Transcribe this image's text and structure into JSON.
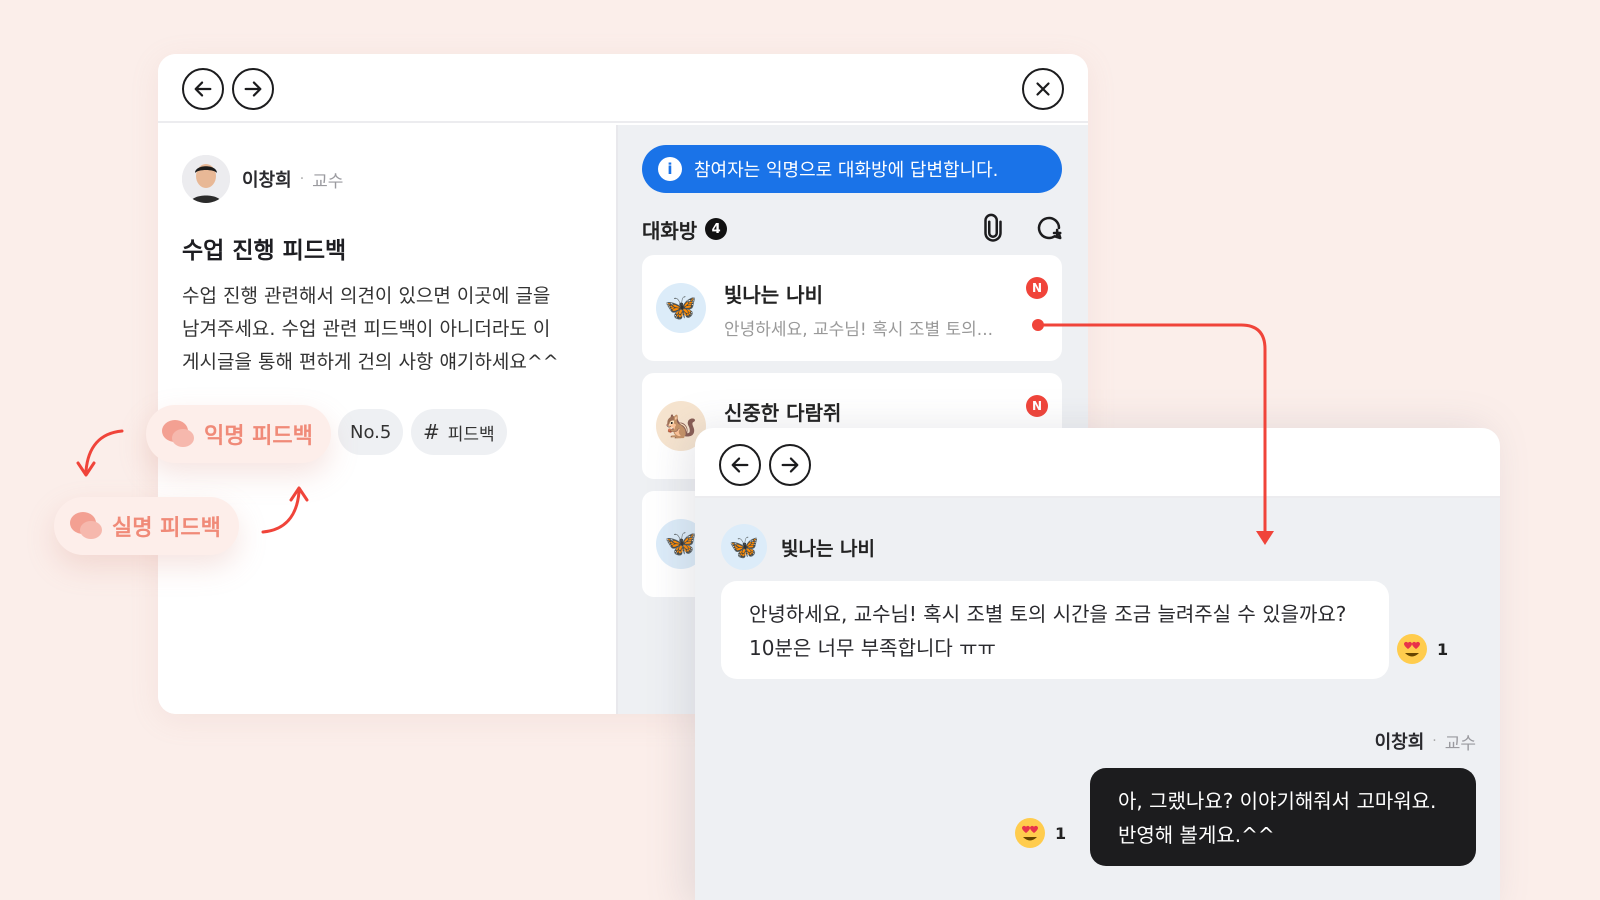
{
  "post": {
    "author_name": "이창희",
    "author_role": "교수",
    "title": "수업 진행 피드백",
    "body_lines": [
      "수업 진행 관련해서 의견이 있으면 이곳에 글을",
      "남겨주세요. 수업 관련 피드백이 아니더라도 이",
      "게시글을 통해 편하게 건의 사항 얘기하세요^^"
    ],
    "tag_number": "No.5",
    "tag_hash": "#",
    "tag_label": "피드백"
  },
  "float_tags": {
    "anonymous": "익명 피드백",
    "real_name": "실명 피드백"
  },
  "chat": {
    "banner": "참여자는 익명으로 대화방에 답변합니다.",
    "banner_icon": "i",
    "header_title": "대화방",
    "room_count": "4",
    "rooms": [
      {
        "name": "빛나는 나비",
        "preview": "안녕하세요, 교수님! 혹시 조별 토의...",
        "badge": "N",
        "icon": "butterfly-icon"
      },
      {
        "name": "신중한 다람쥐",
        "badge": "N",
        "icon": "squirrel-icon"
      },
      {
        "icon": "butterfly-icon"
      }
    ]
  },
  "thread": {
    "sender_name": "빛나는 나비",
    "message_lines": [
      "안녕하세요, 교수님! 혹시 조별 토의 시간을 조금 늘려주실 수 있을까요?",
      "10분은 너무 부족합니다 ㅠㅠ"
    ],
    "message_reaction_count": "1",
    "reply_author_name": "이창희",
    "reply_author_role": "교수",
    "reply_lines": [
      "아, 그랬나요? 이야기해줘서 고마워요.",
      "반영해 볼게요.^^"
    ],
    "reply_reaction_count": "1"
  },
  "colors": {
    "background": "#fbeeea",
    "accent_blue": "#1a73e8",
    "accent_red": "#f0443a",
    "tag_text": "#f08a78"
  }
}
